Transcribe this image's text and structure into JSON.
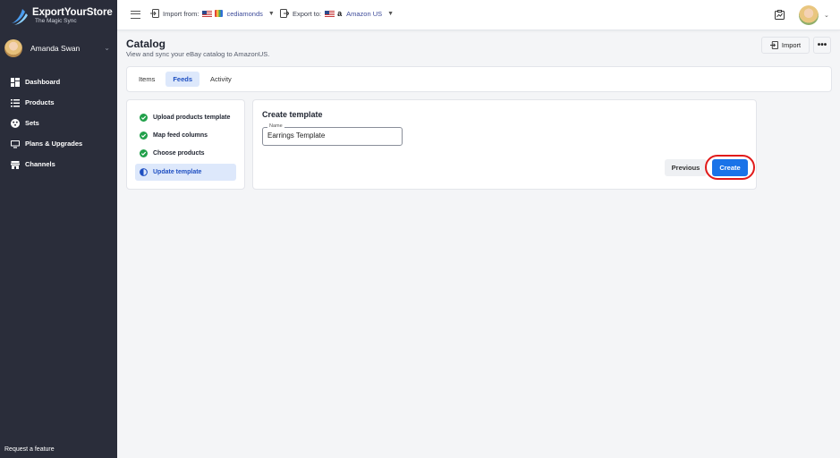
{
  "brand": {
    "name": "ExportYourStore",
    "tagline": "The Magic Sync"
  },
  "user": {
    "name": "Amanda Swan"
  },
  "sidebar": {
    "items": [
      {
        "label": "Dashboard",
        "icon": "dashboard-icon"
      },
      {
        "label": "Products",
        "icon": "list-icon"
      },
      {
        "label": "Sets",
        "icon": "sets-icon"
      },
      {
        "label": "Plans & Upgrades",
        "icon": "monitor-icon"
      },
      {
        "label": "Channels",
        "icon": "store-icon"
      }
    ],
    "request_feature": "Request a feature"
  },
  "topbar": {
    "import_label": "Import from:",
    "import_store": "cediamonds",
    "export_label": "Export to:",
    "export_store": "Amazon US"
  },
  "page": {
    "title": "Catalog",
    "subtitle": "View and sync your eBay catalog to AmazonUS.",
    "import_button": "Import",
    "more_button": "•••"
  },
  "tabs": [
    {
      "label": "Items",
      "active": false
    },
    {
      "label": "Feeds",
      "active": true
    },
    {
      "label": "Activity",
      "active": false
    }
  ],
  "steps": [
    {
      "label": "Upload products template",
      "status": "done"
    },
    {
      "label": "Map feed columns",
      "status": "done"
    },
    {
      "label": "Choose products",
      "status": "done"
    },
    {
      "label": "Update template",
      "status": "current"
    }
  ],
  "form": {
    "title": "Create template",
    "name_label": "Name",
    "name_value": "Earrings Template",
    "previous_button": "Previous",
    "create_button": "Create"
  },
  "colors": {
    "sidebar_bg": "#2a2d3a",
    "accent": "#1a73e8",
    "step_done": "#21a04a",
    "highlight_ring": "#e11a1a"
  }
}
